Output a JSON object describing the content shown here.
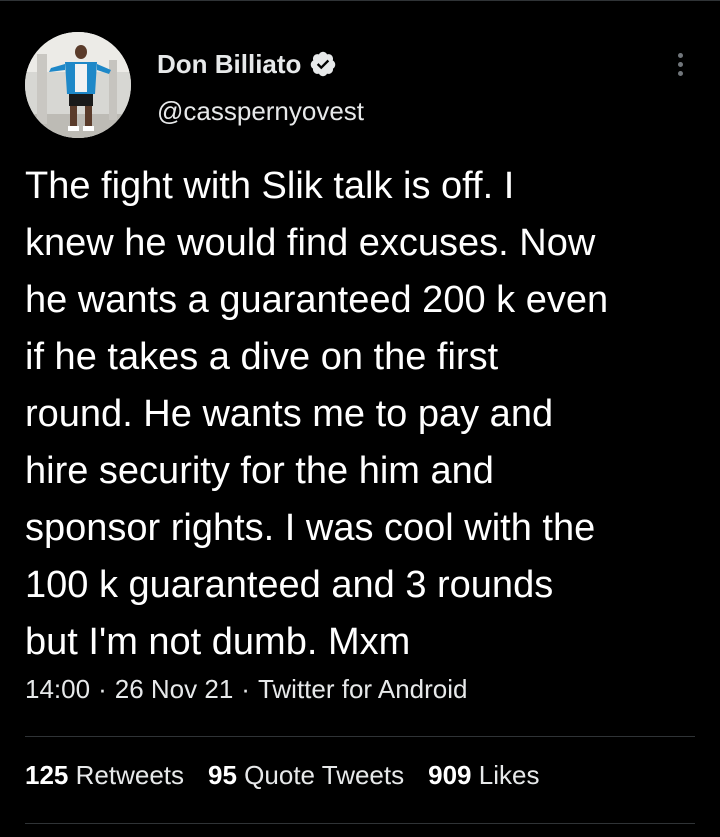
{
  "tweet": {
    "author": {
      "display_name": "Don Billiato",
      "handle": "@casspernyovest",
      "verified": true
    },
    "text_lines": [
      "The fight with Slik talk is off. I",
      "knew he would find excuses. Now",
      "he wants a guaranteed 200 k even",
      "if he takes a dive on the first",
      "round. He wants me to pay and",
      "hire security for the him and",
      "sponsor rights. I was cool with the",
      "100 k guaranteed and 3 rounds",
      "but I'm not dumb. Mxm"
    ],
    "meta": {
      "time": "14:00",
      "separator": "·",
      "date": "26 Nov 21",
      "source": "Twitter for Android"
    },
    "stats": {
      "retweets": {
        "count": "125",
        "label": "Retweets"
      },
      "quotes": {
        "count": "95",
        "label": "Quote Tweets"
      },
      "likes": {
        "count": "909",
        "label": "Likes"
      }
    }
  },
  "icons": {
    "verified": "verified-badge-icon",
    "more": "more-vertical-icon"
  },
  "colors": {
    "background": "#000000",
    "text": "#e7e9ea",
    "divider": "#2f3336",
    "muted": "#71767b"
  }
}
